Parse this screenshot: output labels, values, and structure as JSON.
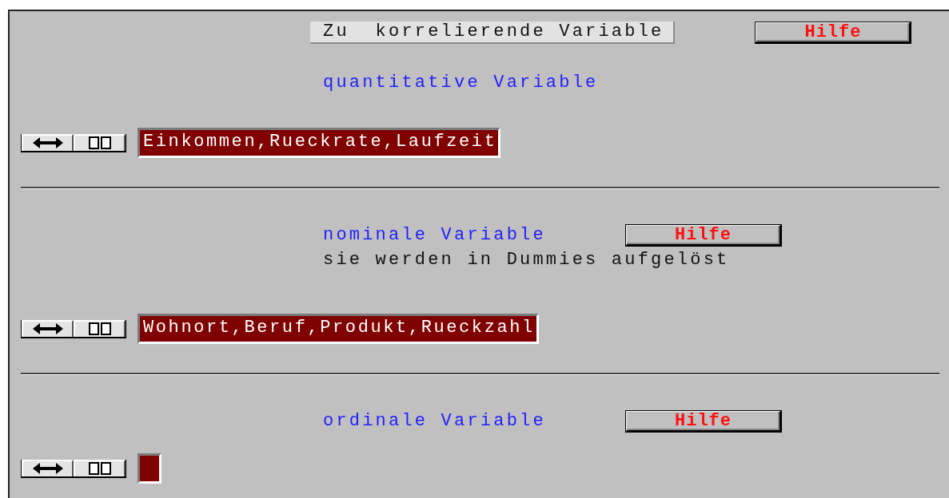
{
  "header": {
    "title": "Zu  korrelierende Variable",
    "help": "Hilfe"
  },
  "sections": [
    {
      "label": "quantitative Variable",
      "value": "Einkommen,Rueckrate,Laufzeit"
    },
    {
      "label": "nominale Variable",
      "help": "Hilfe",
      "note": "sie werden in Dummies aufgelöst",
      "value": "Wohnort,Beruf,Produkt,Rueckzahl"
    },
    {
      "label": "ordinale Variable",
      "help": "Hilfe"
    }
  ]
}
